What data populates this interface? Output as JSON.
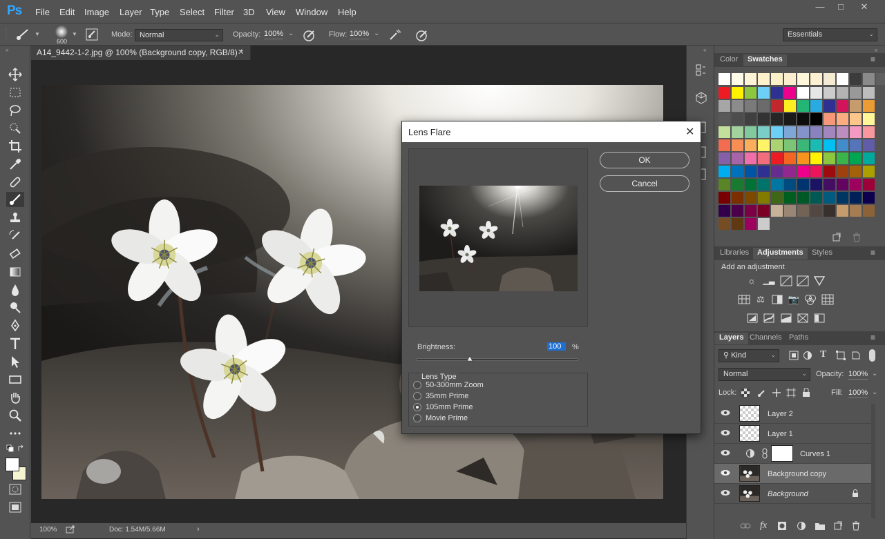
{
  "app": {
    "logo": "Ps"
  },
  "menu": [
    "File",
    "Edit",
    "Image",
    "Layer",
    "Type",
    "Select",
    "Filter",
    "3D",
    "View",
    "Window",
    "Help"
  ],
  "options_bar": {
    "brush_size": "600",
    "mode_label": "Mode:",
    "mode_value": "Normal",
    "opacity_label": "Opacity:",
    "opacity_value": "100%",
    "flow_label": "Flow:",
    "flow_value": "100%",
    "workspace": "Essentials"
  },
  "document": {
    "tab_title": "A14_9442-1-2.jpg @ 100% (Background copy, RGB/8) *",
    "zoom": "100%",
    "doc_info": "Doc: 1.54M/5.66M"
  },
  "dialog": {
    "title": "Lens Flare",
    "ok_label": "OK",
    "cancel_label": "Cancel",
    "brightness_label": "Brightness:",
    "brightness_value": "100",
    "brightness_unit": "%",
    "brightness_fraction": 0.33,
    "lens_type_label": "Lens Type",
    "lens_types": [
      {
        "label": "50-300mm Zoom",
        "selected": false
      },
      {
        "label": "35mm Prime",
        "selected": false
      },
      {
        "label": "105mm Prime",
        "selected": true
      },
      {
        "label": "Movie Prime",
        "selected": false
      }
    ]
  },
  "swatches_panel": {
    "tabs": [
      "Color",
      "Swatches"
    ],
    "active_tab": "Swatches",
    "top_row": [
      "#ffffff",
      "#fffbe6",
      "#fff4d6",
      "#fff1c9",
      "#fbf0c8",
      "#fbeecf",
      "#fff7d9",
      "#fdf1d1",
      "#f5ead2",
      "#ffffff",
      "#3c3c3c",
      "#8a8a8a",
      "#5f5f5f",
      "#d0d0d0"
    ],
    "rows": [
      [
        "#ed1c24",
        "#fff200",
        "#8dc63f",
        "#6dcff6",
        "#2e3192",
        "#ec008c",
        "#ffffff",
        "#e6e6e6",
        "#cccccc",
        "#b3b3b3",
        "#999999",
        "#bdbdbd"
      ],
      [
        "#a6a6a6",
        "#8c8c8c",
        "#7a7a7a",
        "#6b6b6b",
        "#c1272d",
        "#fcee21",
        "#22b573",
        "#29abe2",
        "#2e3192",
        "#d4145a",
        "#c69c6d",
        "#ed9b33"
      ],
      [
        "#595959",
        "#4d4d4d",
        "#404040",
        "#333333",
        "#262626",
        "#1a1a1a",
        "#0d0d0d",
        "#000000",
        "#f7977a",
        "#f9ad81",
        "#fdc68a",
        "#fff79a"
      ],
      [
        "#c4df9b",
        "#a2d39c",
        "#82ca9d",
        "#7bcdc8",
        "#6ecff6",
        "#7ea7d8",
        "#8493ca",
        "#8882be",
        "#a187be",
        "#bc8dbf",
        "#f49ac2",
        "#f6989d"
      ],
      [
        "#f26c4f",
        "#f68e56",
        "#fbaf5d",
        "#fff467",
        "#acd372",
        "#7cc576",
        "#3bb878",
        "#1abbb4",
        "#00bff3",
        "#438ccb",
        "#5574b9",
        "#605ca8"
      ],
      [
        "#8560a8",
        "#a864a8",
        "#f06eaa",
        "#f26d7d",
        "#ed1c24",
        "#f26522",
        "#f7941d",
        "#fff200",
        "#8dc73f",
        "#39b54a",
        "#00a651",
        "#00a99d"
      ],
      [
        "#00aeef",
        "#0072bc",
        "#0054a6",
        "#2e3192",
        "#662d91",
        "#92278f",
        "#ec008c",
        "#ed145b",
        "#9e0b0f",
        "#a0410d",
        "#a36209",
        "#aba000"
      ],
      [
        "#598527",
        "#197b30",
        "#007236",
        "#00746b",
        "#0076a3",
        "#004b80",
        "#003471",
        "#1b1464",
        "#440e62",
        "#630460",
        "#9e005d",
        "#9e0039"
      ],
      [
        "#790000",
        "#7b2e00",
        "#7d4900",
        "#827b00",
        "#406618",
        "#005e20",
        "#005826",
        "#005952",
        "#005b7f",
        "#003663",
        "#002157",
        "#0d004c"
      ],
      [
        "#32004b",
        "#4b0049",
        "#7b0046",
        "#7a0026",
        "#c7b299",
        "#998675",
        "#736357",
        "#534741",
        "#37302d",
        "#c69c6d",
        "#a67c52",
        "#8c6239"
      ],
      [
        "#754c24",
        "#603913",
        "#9e005d",
        "#cccccc"
      ]
    ]
  },
  "adjustments_panel": {
    "tabs": [
      "Libraries",
      "Adjustments",
      "Styles"
    ],
    "active_tab": "Adjustments",
    "heading": "Add an adjustment"
  },
  "layers_panel": {
    "tabs": [
      "Layers",
      "Channels",
      "Paths"
    ],
    "active_tab": "Layers",
    "filter_value": "Kind",
    "blend_mode": "Normal",
    "opacity_label": "Opacity:",
    "opacity_value": "100%",
    "lock_label": "Lock:",
    "fill_label": "Fill:",
    "fill_value": "100%",
    "layers": [
      {
        "name": "Layer 2",
        "type": "transparent",
        "selected": false
      },
      {
        "name": "Layer 1",
        "type": "transparent",
        "selected": false
      },
      {
        "name": "Curves 1",
        "type": "adjustment",
        "selected": false
      },
      {
        "name": "Background copy",
        "type": "image",
        "selected": true
      },
      {
        "name": "Background",
        "type": "image-locked",
        "selected": false
      }
    ]
  }
}
